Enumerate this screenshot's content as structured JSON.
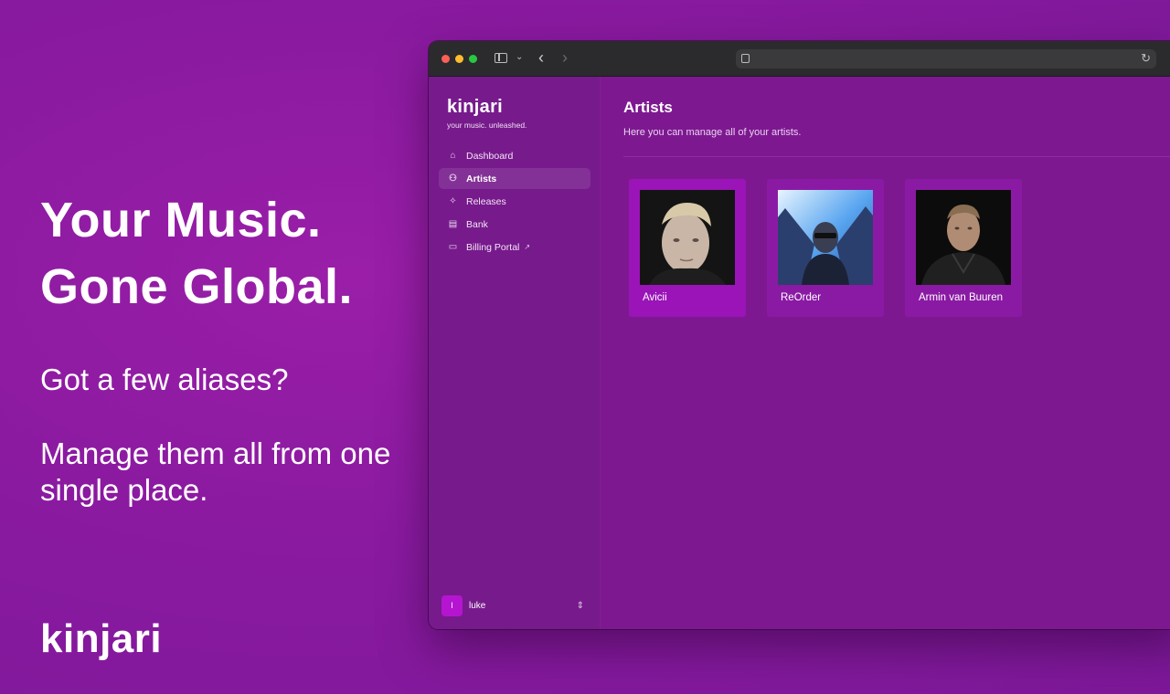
{
  "hero": {
    "title_line1": "Your Music.",
    "title_line2": "Gone Global.",
    "sub1": "Got a few aliases?",
    "sub2": "Manage them all from one single place.",
    "brand": "kinjari"
  },
  "sidebar": {
    "logo": "kinjari",
    "tagline": "your music. unleashed.",
    "items": [
      {
        "label": "Dashboard",
        "icon": "home-icon",
        "active": false
      },
      {
        "label": "Artists",
        "icon": "users-icon",
        "active": true
      },
      {
        "label": "Releases",
        "icon": "sparkles-icon",
        "active": false
      },
      {
        "label": "Bank",
        "icon": "bank-icon",
        "active": false
      },
      {
        "label": "Billing Portal",
        "icon": "credit-card-icon",
        "active": false,
        "external": true
      }
    ],
    "user": {
      "initial": "l",
      "name": "luke"
    }
  },
  "main": {
    "title": "Artists",
    "description": "Here you can manage all of your artists.",
    "artists": [
      {
        "name": "Avicii"
      },
      {
        "name": "ReOrder"
      },
      {
        "name": "Armin van Buuren"
      }
    ]
  },
  "colors": {
    "background": "#8a1aa0",
    "sidebar": "#771a8c",
    "card": "#8a1aa3",
    "card_hover": "#9a14b8",
    "avatar": "#b515d0"
  }
}
